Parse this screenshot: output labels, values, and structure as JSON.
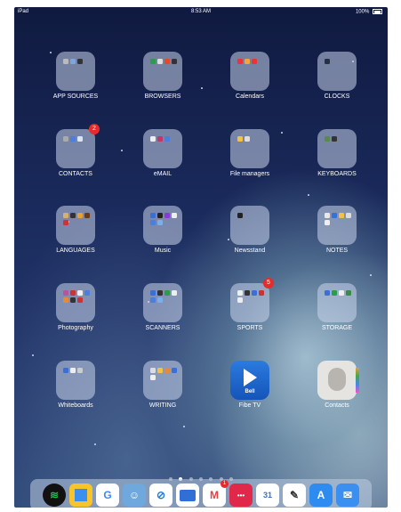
{
  "status": {
    "carrier": "iPad",
    "time": "8:53 AM",
    "battery_pct": "100%"
  },
  "folders": [
    {
      "label": "APP SOURCES"
    },
    {
      "label": "BROWSERS"
    },
    {
      "label": "Calendars"
    },
    {
      "label": "CLOCKS"
    },
    {
      "label": "CONTACTS",
      "badge": "2"
    },
    {
      "label": "eMAIL"
    },
    {
      "label": "File managers"
    },
    {
      "label": "KEYBOARDS"
    },
    {
      "label": "LANGUAGES"
    },
    {
      "label": "Music"
    },
    {
      "label": "Newsstand"
    },
    {
      "label": "NOTES"
    },
    {
      "label": "Photography"
    },
    {
      "label": "SCANNERS"
    },
    {
      "label": "SPORTS",
      "badge": "5"
    },
    {
      "label": "STORAGE"
    },
    {
      "label": "Whiteboards"
    },
    {
      "label": "WRITING"
    },
    {
      "label": "Fibe TV",
      "app_text": "Bell"
    },
    {
      "label": "Contacts"
    }
  ],
  "dock": {
    "apps": [
      {
        "name": "Spotify",
        "color": "#1db954",
        "glyph": "≋"
      },
      {
        "name": "Notes",
        "color": "#f7c52b",
        "glyph": ""
      },
      {
        "name": "Google",
        "color": "#ffffff",
        "glyph": "G"
      },
      {
        "name": "Bitmoji",
        "color": "#6fa8dc",
        "glyph": "☺"
      },
      {
        "name": "Safari",
        "color": "#1f7ce0",
        "glyph": "⊘"
      },
      {
        "name": "Files",
        "color": "#2f6fd6",
        "glyph": ""
      },
      {
        "name": "Gmail",
        "color": "#ffffff",
        "glyph": "M",
        "badge": "1"
      },
      {
        "name": "Messenger",
        "color": "#e0294a",
        "glyph": "•••"
      },
      {
        "name": "Calendar",
        "color": "#ffffff",
        "glyph": "31"
      },
      {
        "name": "Pencil",
        "color": "#ffffff",
        "glyph": "✎"
      },
      {
        "name": "App Store",
        "color": "#2e8bf0",
        "glyph": "A"
      },
      {
        "name": "Mail",
        "color": "#3a8ff0",
        "glyph": "✉"
      }
    ]
  },
  "page_dots": {
    "count": 7,
    "active": 1
  }
}
